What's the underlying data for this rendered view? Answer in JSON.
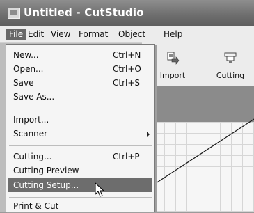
{
  "window": {
    "title": "Untitled - CutStudio"
  },
  "menubar": {
    "items": [
      "File",
      "Edit",
      "View",
      "Format",
      "Object",
      "Help"
    ]
  },
  "toolbar": {
    "buttons": [
      {
        "label": "Import",
        "icon": "import-icon"
      },
      {
        "label": "Cutting",
        "icon": "cutting-icon"
      }
    ]
  },
  "file_menu": {
    "items": [
      {
        "label": "New...",
        "shortcut": "Ctrl+N"
      },
      {
        "label": "Open...",
        "shortcut": "Ctrl+O"
      },
      {
        "label": "Save",
        "shortcut": "Ctrl+S"
      },
      {
        "label": "Save As...",
        "shortcut": ""
      },
      {
        "label": "Import...",
        "shortcut": ""
      },
      {
        "label": "Scanner",
        "shortcut": ""
      },
      {
        "label": "Cutting...",
        "shortcut": "Ctrl+P"
      },
      {
        "label": "Cutting Preview",
        "shortcut": ""
      },
      {
        "label": "Cutting Setup...",
        "shortcut": "",
        "highlighted": true
      },
      {
        "label": "Print & Cut",
        "shortcut": ""
      }
    ]
  }
}
